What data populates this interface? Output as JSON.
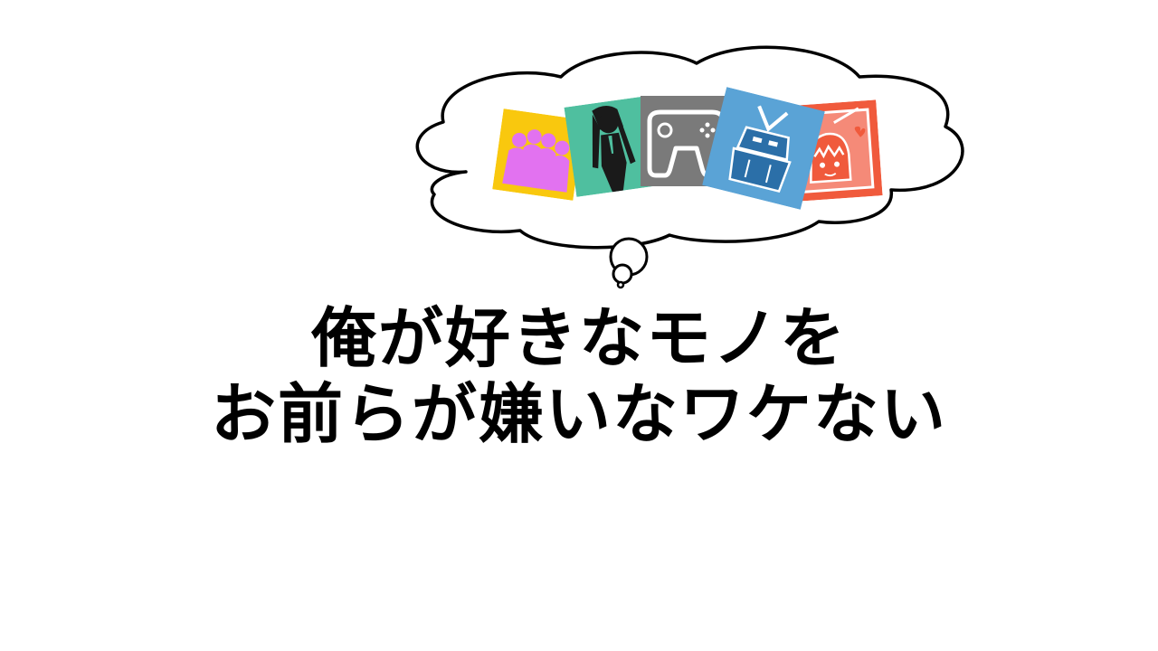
{
  "slide": {
    "headline_line1": "俺が好きなモノを",
    "headline_line2": "お前らが嫌いなワケない"
  },
  "colors": {
    "background": "#ffffff",
    "text": "#000000",
    "idol_bg": "#f9c80e",
    "idol_fg": "#e272f0",
    "vocaloid_bg": "#4fbf9f",
    "game_bg": "#7a7a7a",
    "robot_bg": "#5aa3d6",
    "anime_bg": "#f05a3c"
  },
  "icons": [
    "idol-group-icon",
    "vocaloid-singer-icon",
    "game-controller-icon",
    "mecha-robot-icon",
    "anime-girl-icon"
  ]
}
